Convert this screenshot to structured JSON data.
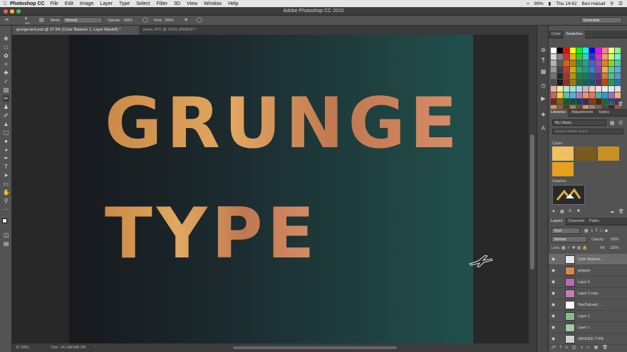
{
  "menubar": {
    "app": "Photoshop CC",
    "items": [
      "File",
      "Edit",
      "Image",
      "Layer",
      "Type",
      "Select",
      "Filter",
      "3D",
      "View",
      "Window",
      "Help"
    ],
    "battery": "99%",
    "clock": "Thu 14:42",
    "user": "Ben Halsall"
  },
  "window": {
    "title": "Adobe Photoshop CC 2015"
  },
  "options": {
    "brush_size": "200",
    "mode_label": "Mode:",
    "mode_value": "Normal",
    "opacity_label": "Opacity:",
    "opacity_value": "100%",
    "flow_label": "Flow:",
    "flow_value": "100%",
    "workspace": "Essentials"
  },
  "tabs": [
    {
      "label": "grunge-text.psd @ 37.5% (Color Balance 1, Layer Mask/8) *"
    },
    {
      "label": "plane.JPG @ 100% (RGB/8*) *"
    }
  ],
  "canvas": {
    "line1": "GRUNGE",
    "line2": "TYPE"
  },
  "status": {
    "zoom": "37.45%",
    "doc": "Doc: 24.1M/148.7M"
  },
  "color_panel": {
    "tab_color": "Color",
    "tab_swatches": "Swatches"
  },
  "libraries_panel": {
    "tab_libraries": "Libraries",
    "tab_adjustments": "Adjustments",
    "tab_styles": "Styles",
    "library": "My Library",
    "search_placeholder": "Search Adobe Stock",
    "colors_label": "Colors",
    "graphics_label": "Graphics",
    "colors": [
      "#f0c060",
      "#7a5a1e",
      "#c8901e",
      "#e8a020"
    ]
  },
  "layers_panel": {
    "tab_layers": "Layers",
    "tab_channels": "Channels",
    "tab_paths": "Paths",
    "kind": "Kind",
    "blend": "Normal",
    "opacity_label": "Opacity:",
    "opacity": "100%",
    "lock_label": "Lock:",
    "fill_label": "Fill:",
    "fill": "100%",
    "layers": [
      {
        "name": "Color Balance...",
        "selected": true
      },
      {
        "name": "polygon",
        "selected": false
      },
      {
        "name": "Layer 3",
        "selected": false
      },
      {
        "name": "Layer 2 copy",
        "selected": false
      },
      {
        "name": "Hue/Saturati...",
        "selected": false
      },
      {
        "name": "Layer 2",
        "selected": false
      },
      {
        "name": "Layer 1",
        "selected": false
      },
      {
        "name": "GRUNGE TYPE",
        "selected": false
      }
    ]
  }
}
